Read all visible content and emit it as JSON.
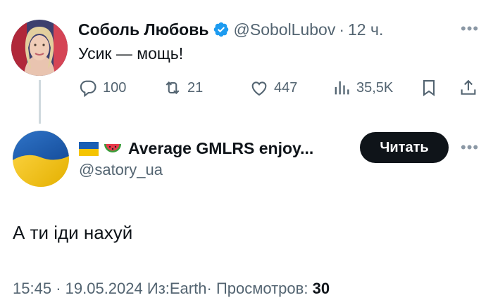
{
  "parent_tweet": {
    "author_name": "Соболь Любовь",
    "author_handle": "@SobolLubov",
    "separator": "·",
    "time": "12 ч.",
    "text": "Усик — мощь!",
    "verified": true,
    "more_icon": "more-dots-icon",
    "actions": {
      "replies": "100",
      "retweets": "21",
      "likes": "447",
      "views": "35,5K"
    }
  },
  "reply_tweet": {
    "author_name": "Average GMLRS enjoy...",
    "author_handle": "@satory_ua",
    "name_emojis": [
      "flag-ukraine",
      "watermelon"
    ],
    "follow_label": "Читать",
    "text": "А ти іди нахуй",
    "meta": {
      "time": "15:45",
      "sep1": "·",
      "date": "19.05.2024",
      "source": "Из:Earth",
      "sep2": "·",
      "views_label": "Просмотров:",
      "views_count": "30"
    }
  },
  "colors": {
    "text_primary": "#0f1419",
    "text_secondary": "#536471",
    "verified_blue": "#1d9bf0",
    "follow_button_bg": "#0f1419",
    "thread_line": "#cfd9de",
    "ukraine_blue": "#1a5fb4",
    "ukraine_yellow": "#f5c400"
  }
}
